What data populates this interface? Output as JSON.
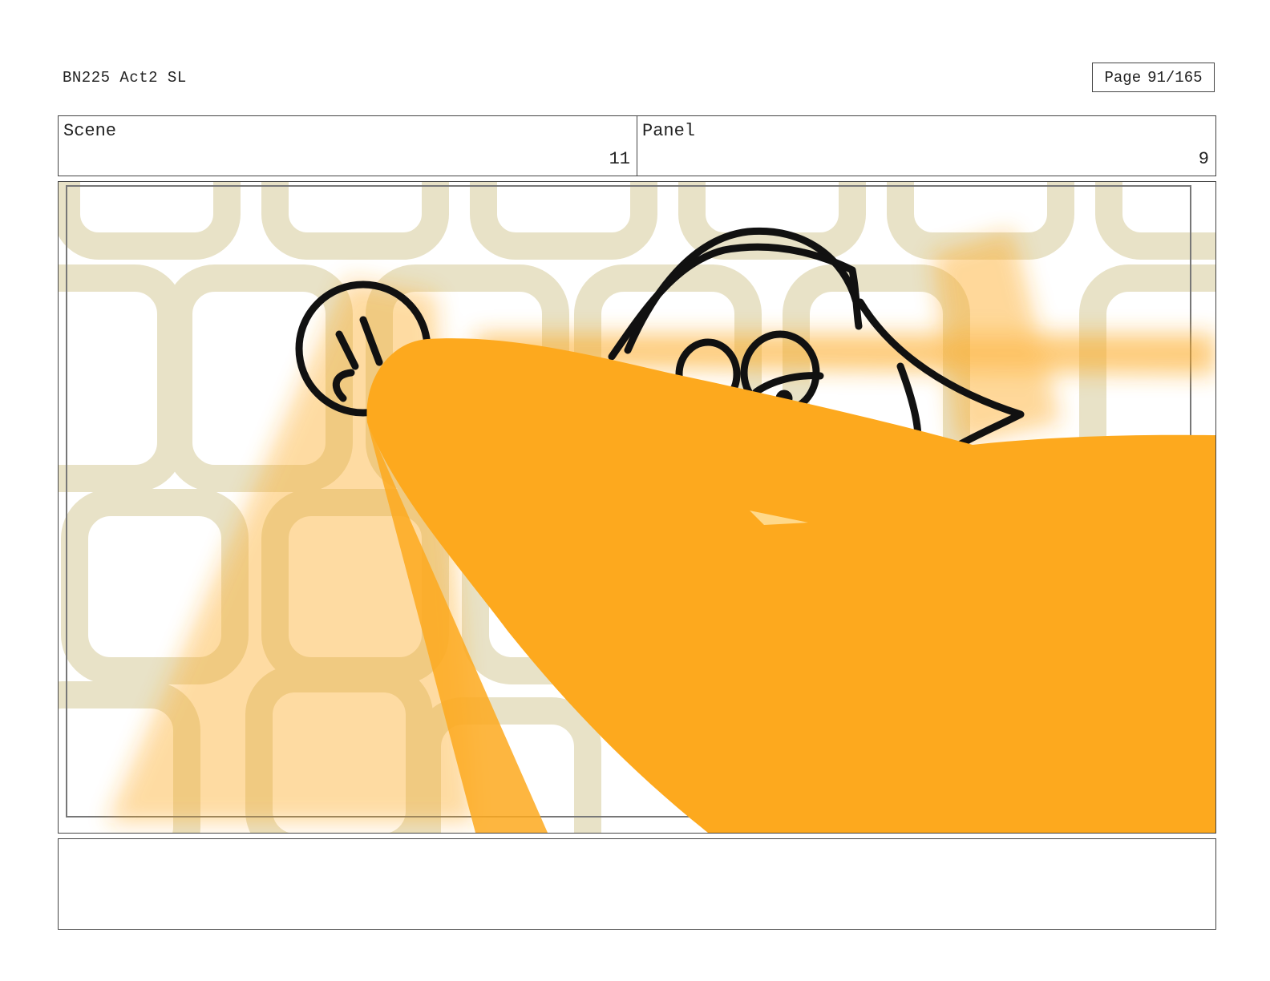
{
  "header": {
    "doc_id": "BN225 Act2 SL",
    "page_label": "Page",
    "page_number": "91/165"
  },
  "scene": {
    "label": "Scene",
    "value": "11"
  },
  "panel": {
    "label": "Panel",
    "value": "9"
  },
  "colors": {
    "orange": "#FDA91E",
    "wallpaper": "#E8E2C7",
    "line": "#111111"
  },
  "caption": ""
}
